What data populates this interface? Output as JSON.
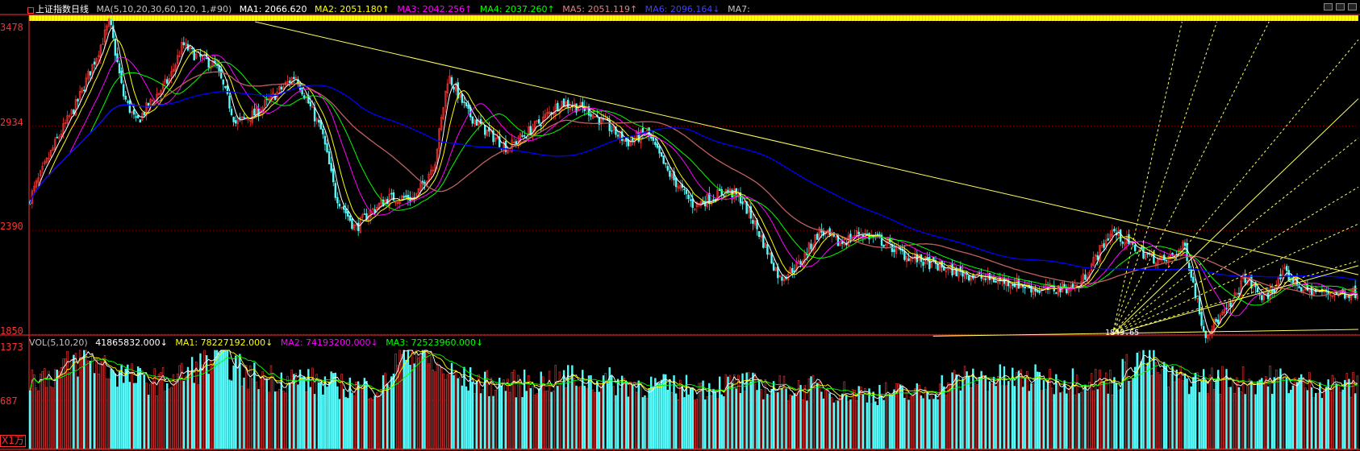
{
  "legend": {
    "title": "上证指数日线",
    "ma_params": "MA(5,10,20,30,60,120,  1,#90)",
    "ma1": "MA1: 2066.620",
    "ma2": "MA2: 2051.180↑",
    "ma3": "MA3: 2042.256↑",
    "ma4": "MA4: 2037.260↑",
    "ma5": "MA5: 2051.119↑",
    "ma6": "MA6: 2096.164↓",
    "ma7": "MA7:"
  },
  "vol_legend": {
    "params": "VOL(5,10,20)",
    "vol": "41865832.000↓",
    "ma1": "MA1: 78227192.000↓",
    "ma2": "MA2: 74193200.000↓",
    "ma3": "MA3: 72523960.000↓"
  },
  "unit": "X1万",
  "low_annotation": "1849.65",
  "colors": {
    "ma1": "#ffffff",
    "ma2": "#ffff00",
    "ma3": "#ff00ff",
    "ma4": "#00ff00",
    "ma5": "#c06060",
    "ma6": "#0000ff",
    "up": "#ff3232",
    "down": "#54fcfc",
    "axis": "#ff3030",
    "grid": "#800000",
    "trend": "#ffff60"
  },
  "chart_data": {
    "type": "candlestick",
    "price_axis": {
      "labels": [
        "3478",
        "2934",
        "2390",
        "1850"
      ],
      "values": [
        3478,
        2934,
        2390,
        1850
      ],
      "ylim": [
        1850,
        3478
      ]
    },
    "volume_axis": {
      "labels": [
        "1373",
        "687"
      ],
      "values": [
        1373,
        687
      ],
      "unit": "X1万"
    },
    "anchors": {
      "x": [
        0,
        0.02,
        0.035,
        0.05,
        0.06,
        0.07,
        0.08,
        0.09,
        0.105,
        0.115,
        0.125,
        0.14,
        0.155,
        0.17,
        0.185,
        0.2,
        0.21,
        0.22,
        0.23,
        0.245,
        0.255,
        0.27,
        0.29,
        0.305,
        0.315,
        0.33,
        0.345,
        0.36,
        0.38,
        0.4,
        0.42,
        0.45,
        0.465,
        0.48,
        0.5,
        0.525,
        0.535,
        0.545,
        0.565,
        0.58,
        0.595,
        0.61,
        0.625,
        0.64,
        0.66,
        0.69,
        0.72,
        0.74,
        0.76,
        0.79,
        0.815,
        0.83,
        0.845,
        0.855,
        0.87,
        0.885,
        0.905,
        0.915,
        0.93,
        0.945,
        0.96,
        0.985,
        1.0
      ],
      "close": [
        2560,
        2860,
        3050,
        3300,
        3478,
        3100,
        2950,
        3050,
        3180,
        3360,
        3300,
        3250,
        2950,
        3000,
        3100,
        3200,
        3050,
        2900,
        2580,
        2400,
        2480,
        2560,
        2560,
        2750,
        3200,
        3000,
        2900,
        2820,
        2930,
        3060,
        3020,
        2850,
        2900,
        2700,
        2520,
        2600,
        2560,
        2440,
        2140,
        2220,
        2390,
        2320,
        2380,
        2340,
        2260,
        2190,
        2140,
        2120,
        2080,
        2100,
        2390,
        2310,
        2250,
        2230,
        2310,
        1849,
        2000,
        2150,
        2030,
        2170,
        2080,
        2060,
        2070
      ]
    },
    "volume_envelope": [
      900,
      950,
      1180,
      1000,
      870,
      850,
      990,
      1200,
      920,
      900,
      880,
      810,
      780,
      770,
      1360,
      1020,
      870,
      820,
      820,
      850,
      900,
      860,
      830,
      790,
      770,
      780,
      820,
      790,
      760,
      770,
      720,
      700,
      700,
      700,
      860,
      900,
      880,
      880,
      860,
      880,
      850,
      1180,
      900,
      860,
      880,
      860,
      880,
      820,
      810,
      800
    ],
    "trend_line": {
      "from": [
        0.17,
        3478
      ],
      "to": [
        1.0,
        2160
      ]
    },
    "support_line": {
      "from": [
        0.68,
        1840
      ],
      "to": [
        1.0,
        1875
      ]
    },
    "fan_origin": [
      0.815,
      1849
    ],
    "fan_slopes": [
      0.3,
      0.45,
      0.6,
      0.8,
      1.2,
      2.0,
      3.0,
      4.5
    ],
    "solid_fan_slopes": [
      0.24,
      0.07
    ]
  }
}
